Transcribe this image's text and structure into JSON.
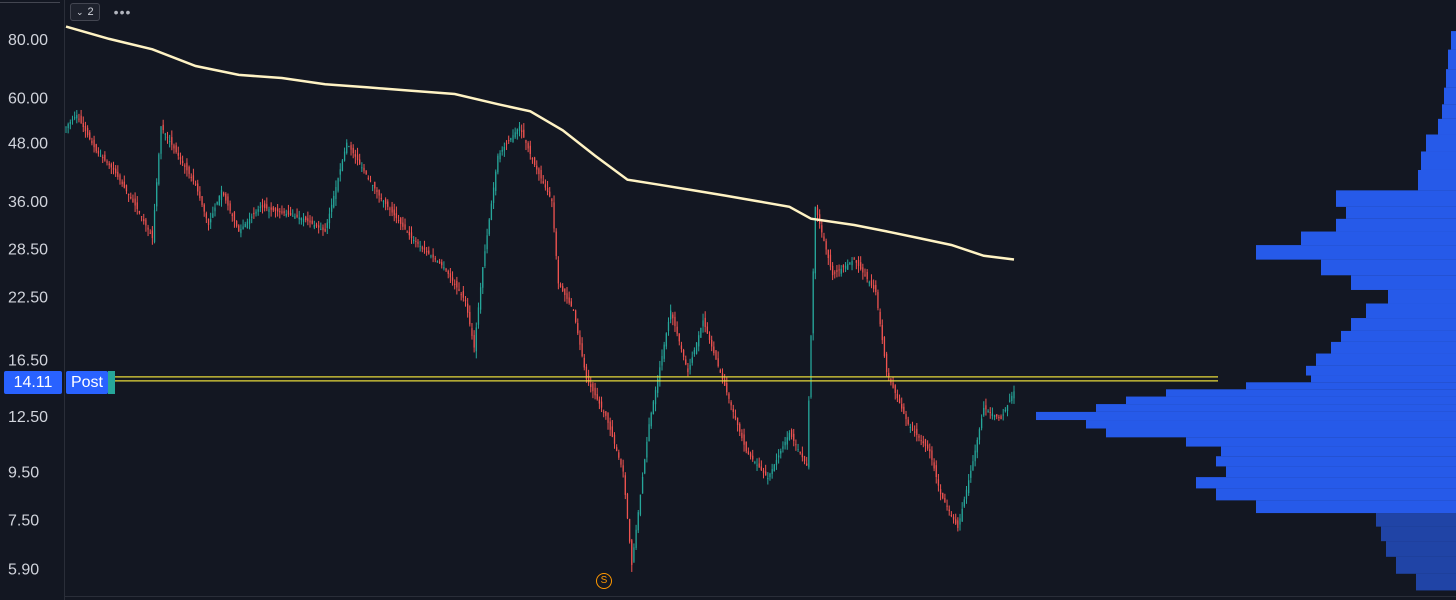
{
  "toolbar": {
    "layout_count": "2",
    "more_icon": "more-horizontal-icon",
    "chevron_icon": "chevron-down-icon"
  },
  "price_badge": {
    "value": "14.11",
    "session": "Post",
    "color": "#2962ff"
  },
  "session_marker": {
    "label": "S",
    "color": "#ff9800"
  },
  "chart_data": {
    "type": "candlestick",
    "yscale": "log",
    "ylim": [
      5.2,
      95
    ],
    "yticks": [
      "80.00",
      "60.00",
      "48.00",
      "36.00",
      "28.50",
      "22.50",
      "16.50",
      "12.50",
      "9.50",
      "7.50",
      "5.90"
    ],
    "up_color": "#26a69a",
    "down_color": "#ef5350",
    "close_anchors": [
      [
        0,
        52
      ],
      [
        5,
        55
      ],
      [
        14,
        46
      ],
      [
        22,
        42
      ],
      [
        34,
        34
      ],
      [
        40,
        30
      ],
      [
        44,
        52
      ],
      [
        52,
        45
      ],
      [
        60,
        39
      ],
      [
        66,
        32
      ],
      [
        72,
        38
      ],
      [
        80,
        31
      ],
      [
        90,
        35
      ],
      [
        100,
        34
      ],
      [
        110,
        33
      ],
      [
        120,
        31
      ],
      [
        130,
        48
      ],
      [
        145,
        37
      ],
      [
        160,
        30
      ],
      [
        175,
        26
      ],
      [
        185,
        22
      ],
      [
        189,
        17.5
      ],
      [
        193,
        26
      ],
      [
        200,
        45
      ],
      [
        210,
        52
      ],
      [
        217,
        43
      ],
      [
        225,
        36
      ],
      [
        228,
        24
      ],
      [
        235,
        21
      ],
      [
        241,
        15
      ],
      [
        250,
        12.5
      ],
      [
        258,
        9.5
      ],
      [
        262,
        6.0
      ],
      [
        270,
        12
      ],
      [
        280,
        21
      ],
      [
        288,
        15.5
      ],
      [
        295,
        20
      ],
      [
        305,
        14.5
      ],
      [
        315,
        10.5
      ],
      [
        325,
        9.2
      ],
      [
        335,
        11.5
      ],
      [
        343,
        9.8
      ],
      [
        347,
        35
      ],
      [
        355,
        25
      ],
      [
        365,
        27
      ],
      [
        375,
        23
      ],
      [
        380,
        15.5
      ],
      [
        390,
        12
      ],
      [
        400,
        10.5
      ],
      [
        405,
        8.5
      ],
      [
        413,
        7.2
      ],
      [
        420,
        10
      ],
      [
        425,
        13
      ],
      [
        433,
        12.3
      ],
      [
        439,
        14.11
      ]
    ],
    "ma_line": {
      "color": "#fff3c4",
      "points": [
        [
          0,
          85
        ],
        [
          20,
          80
        ],
        [
          40,
          76
        ],
        [
          60,
          70
        ],
        [
          80,
          67
        ],
        [
          100,
          66
        ],
        [
          120,
          64
        ],
        [
          140,
          63
        ],
        [
          160,
          62
        ],
        [
          180,
          61
        ],
        [
          200,
          58
        ],
        [
          215,
          56
        ],
        [
          230,
          51
        ],
        [
          245,
          45
        ],
        [
          260,
          40
        ],
        [
          275,
          39
        ],
        [
          290,
          38
        ],
        [
          305,
          37
        ],
        [
          320,
          36
        ],
        [
          335,
          35
        ],
        [
          345,
          33
        ],
        [
          365,
          32
        ],
        [
          380,
          31
        ],
        [
          395,
          30
        ],
        [
          410,
          29
        ],
        [
          425,
          27.5
        ],
        [
          439,
          27
        ]
      ]
    },
    "horizontal_line": {
      "value": 15.0,
      "color": "#e6d93a"
    },
    "volume_profile": {
      "color": "#2962ff",
      "levels": [
        [
          5.5,
          40
        ],
        [
          6.0,
          60
        ],
        [
          6.5,
          70
        ],
        [
          7.0,
          75
        ],
        [
          7.5,
          80
        ],
        [
          8.0,
          200
        ],
        [
          8.5,
          240
        ],
        [
          9.0,
          260
        ],
        [
          9.5,
          230
        ],
        [
          10.0,
          240
        ],
        [
          10.5,
          235
        ],
        [
          11.0,
          270
        ],
        [
          11.5,
          350
        ],
        [
          12.0,
          370
        ],
        [
          12.5,
          420
        ],
        [
          13.0,
          360
        ],
        [
          13.5,
          330
        ],
        [
          14.0,
          290
        ],
        [
          14.5,
          210
        ],
        [
          15.0,
          145
        ],
        [
          15.5,
          150
        ],
        [
          16.5,
          140
        ],
        [
          17.5,
          125
        ],
        [
          18.5,
          115
        ],
        [
          19.5,
          105
        ],
        [
          21,
          90
        ],
        [
          22.5,
          68
        ],
        [
          24,
          105
        ],
        [
          26,
          135
        ],
        [
          28,
          200
        ],
        [
          30,
          155
        ],
        [
          32,
          120
        ],
        [
          34,
          110
        ],
        [
          36,
          120
        ],
        [
          40,
          38
        ],
        [
          44,
          35
        ],
        [
          48,
          30
        ],
        [
          52,
          18
        ],
        [
          56,
          14
        ],
        [
          60,
          12
        ],
        [
          66,
          10
        ],
        [
          72,
          8
        ],
        [
          80,
          5
        ]
      ]
    }
  }
}
